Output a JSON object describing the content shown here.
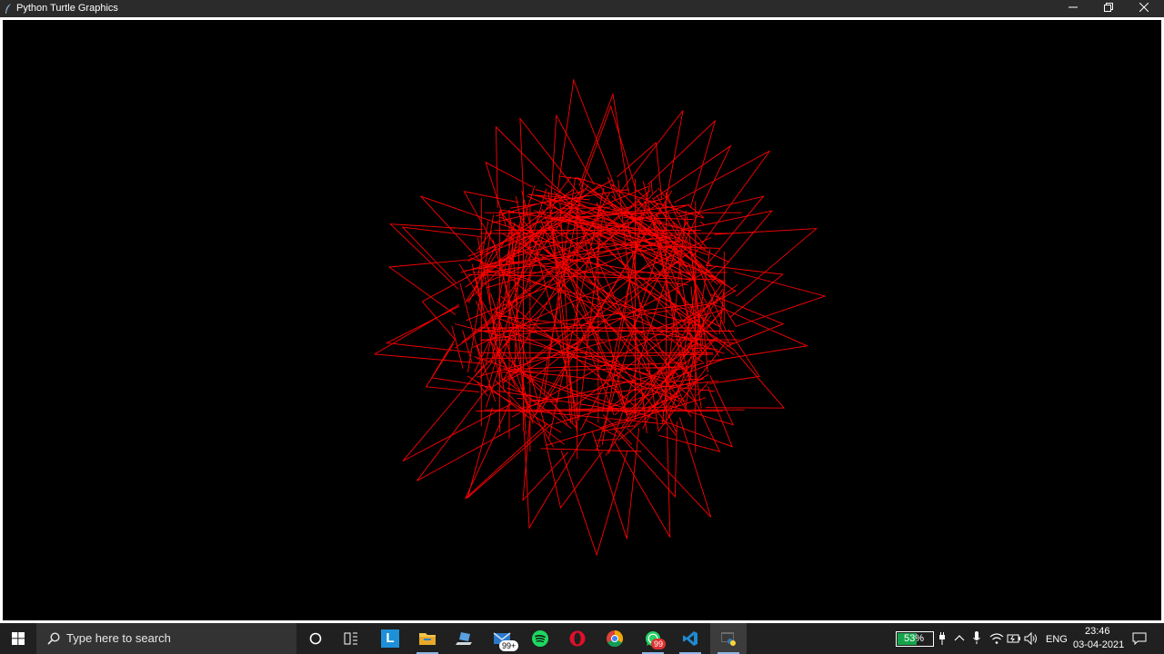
{
  "window": {
    "title": "Python Turtle Graphics",
    "controls": [
      "minimize",
      "restore",
      "close"
    ]
  },
  "drawing": {
    "background": "#000000",
    "stroke_color": "#ff0000"
  },
  "taskbar": {
    "search_placeholder": "Type here to search",
    "apps": [
      {
        "name": "cortana-icon"
      },
      {
        "name": "task-view-icon"
      },
      {
        "name": "l-app-icon",
        "label": "L"
      },
      {
        "name": "file-explorer-icon"
      },
      {
        "name": "laptop-app-icon"
      },
      {
        "name": "mail-icon",
        "badge": "99+"
      },
      {
        "name": "spotify-icon"
      },
      {
        "name": "opera-icon"
      },
      {
        "name": "chrome-icon"
      },
      {
        "name": "whatsapp-icon",
        "badge": "99"
      },
      {
        "name": "vscode-icon"
      },
      {
        "name": "python-icon"
      }
    ],
    "tray": {
      "battery_percent": "53%",
      "language": "ENG",
      "time": "23:46",
      "date": "03-04-2021"
    }
  }
}
